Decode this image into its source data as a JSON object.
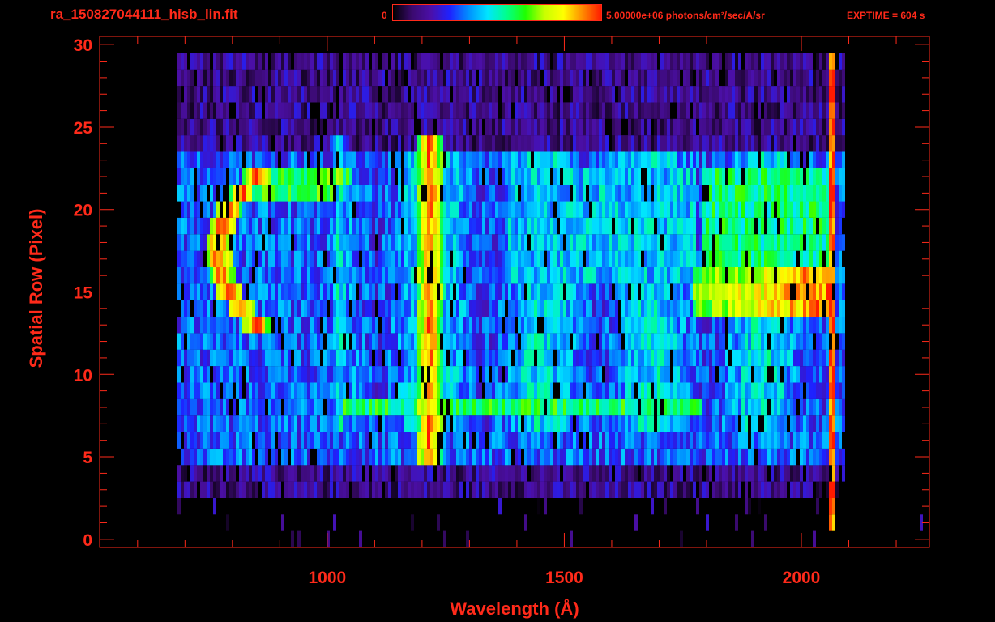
{
  "header": {
    "filename": "ra_150827044111_hisb_lin.fit",
    "colorbar_min": "0",
    "colorbar_max": "5.00000e+06 photons/cm²/sec/A/sr",
    "exptime": "EXPTIME = 604 s"
  },
  "colors": {
    "axis": "#ff2a1a",
    "background": "#000000",
    "colormap": [
      "#000000",
      "#3a0a6e",
      "#4b0fa8",
      "#1e22ff",
      "#0090ff",
      "#00e5ff",
      "#00ff8c",
      "#20ff00",
      "#c8ff00",
      "#ffff00",
      "#ff8c00",
      "#ff1a00"
    ]
  },
  "chart_data": {
    "type": "heatmap",
    "title": "ra_150827044111_hisb_lin.fit",
    "xlabel": "Wavelength (Å)",
    "ylabel": "Spatial Row (Pixel)",
    "xlim": [
      520,
      2270
    ],
    "ylim": [
      -0.5,
      30.5
    ],
    "xticks": [
      1000,
      1500,
      2000
    ],
    "yticks": [
      0,
      5,
      10,
      15,
      20,
      25,
      30
    ],
    "x_minor_step": 100,
    "y_minor_step": 1,
    "colorbar": {
      "min": 0,
      "max": 5000000,
      "units": "photons/cm²/sec/A/sr"
    },
    "exptime_s": 604,
    "x_data_range": [
      682,
      2090
    ],
    "features": [
      {
        "kind": "emission_line",
        "wavelength": 1216,
        "rows": [
          5,
          24
        ],
        "peak_level": 0.95
      },
      {
        "kind": "emission_line",
        "wavelength": 1026,
        "rows": [
          7,
          24
        ],
        "peak_level": 0.5
      },
      {
        "kind": "arc",
        "center_wavelength": 770,
        "rows": [
          13,
          22
        ],
        "peak_level": 1.0
      },
      {
        "kind": "band",
        "row": 8,
        "wavelength_range": [
          1030,
          1790
        ],
        "level": 0.58
      },
      {
        "kind": "band",
        "row": 15,
        "wavelength_range": [
          1770,
          2060
        ],
        "level": 0.78
      },
      {
        "kind": "region",
        "rows": [
          16,
          22
        ],
        "wavelength_range": [
          1790,
          2060
        ],
        "level": 0.55
      },
      {
        "kind": "edge",
        "wavelength": 2063,
        "rows": [
          1,
          29
        ],
        "level": 0.95
      }
    ]
  }
}
